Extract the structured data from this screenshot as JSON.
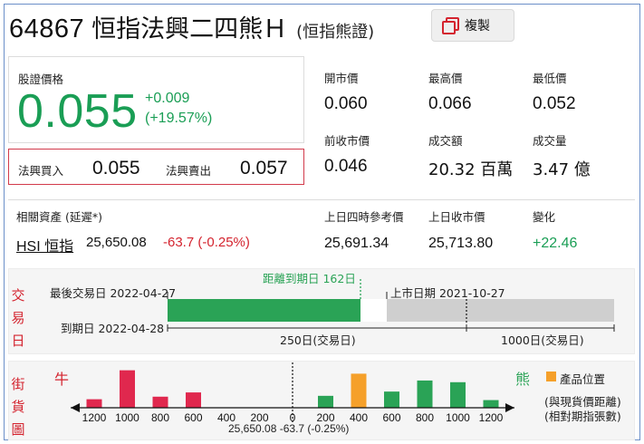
{
  "header": {
    "code": "64867",
    "name": "恒指法興二四熊Ｈ",
    "subtitle": "(恒指熊證)",
    "copy_label": "複製"
  },
  "price": {
    "label": "股證價格",
    "value": "0.055",
    "change": "+0.009",
    "change_pct": "(+19.57%)",
    "bid_label": "法興買入",
    "bid": "0.055",
    "ask_label": "法興賣出",
    "ask": "0.057"
  },
  "stats": [
    {
      "label": "開市價",
      "value": "0.060"
    },
    {
      "label": "最高價",
      "value": "0.066"
    },
    {
      "label": "最低價",
      "value": "0.052"
    },
    {
      "label": "前收市價",
      "value": "0.046"
    },
    {
      "label": "成交額",
      "value": "20.32 百萬"
    },
    {
      "label": "成交量",
      "value": "3.47 億"
    }
  ],
  "underlying": {
    "label": "相關資產 (延遲*)",
    "link": "HSI 恒指",
    "price": "25,650.08",
    "change": "-63.7 (-0.25%)",
    "ref_label": "上日四時參考價",
    "ref_value": "25,691.34",
    "close_label": "上日收市價",
    "close_value": "25,713.80",
    "diff_label": "變化",
    "diff_value": "+22.46"
  },
  "timeline": {
    "label": "交易日",
    "last_trade": "最後交易日 2022-04-27",
    "expiry": "到期日 2022-04-28",
    "days_to_expiry": "距離到期日 162日",
    "listing": "上市日期 2021-10-27",
    "trading_days": "250日(交易日)",
    "total_days": "1000日(交易日)",
    "progress_fraction": 0.84,
    "colors": {
      "bar": "#2aa356",
      "rest": "#cfcfcf",
      "dots": "#2aa356"
    }
  },
  "street": {
    "label": "街貨圖",
    "bull": "牛",
    "bear": "熊",
    "legend": "產品位置",
    "note1": "(與現貨價距離)",
    "note2": "(相對期指張數)",
    "axis_note": "25,650.08 -63.7 (-0.25%)",
    "colors": {
      "bull": "#e0284e",
      "bear": "#2aa356",
      "product": "#f5a02a"
    }
  },
  "chart_data": {
    "type": "bar",
    "categories": [
      "1200",
      "1000",
      "800",
      "600",
      "400",
      "200",
      "0",
      "200",
      "400",
      "600",
      "800",
      "1000",
      "1200"
    ],
    "series": [
      {
        "name": "牛",
        "values": [
          1.0,
          4.4,
          1.3,
          1.8,
          0,
          0,
          0,
          0,
          0,
          0,
          0,
          0,
          0
        ]
      },
      {
        "name": "熊",
        "values": [
          0,
          0,
          0,
          0,
          0,
          0,
          0,
          1.4,
          0,
          1.9,
          3.2,
          3.0,
          0.9
        ]
      },
      {
        "name": "產品位置",
        "values": [
          0,
          0,
          0,
          0,
          0,
          0,
          0,
          0,
          4.0,
          0,
          0,
          0,
          0
        ]
      }
    ],
    "ylim": [
      0,
      5
    ]
  }
}
